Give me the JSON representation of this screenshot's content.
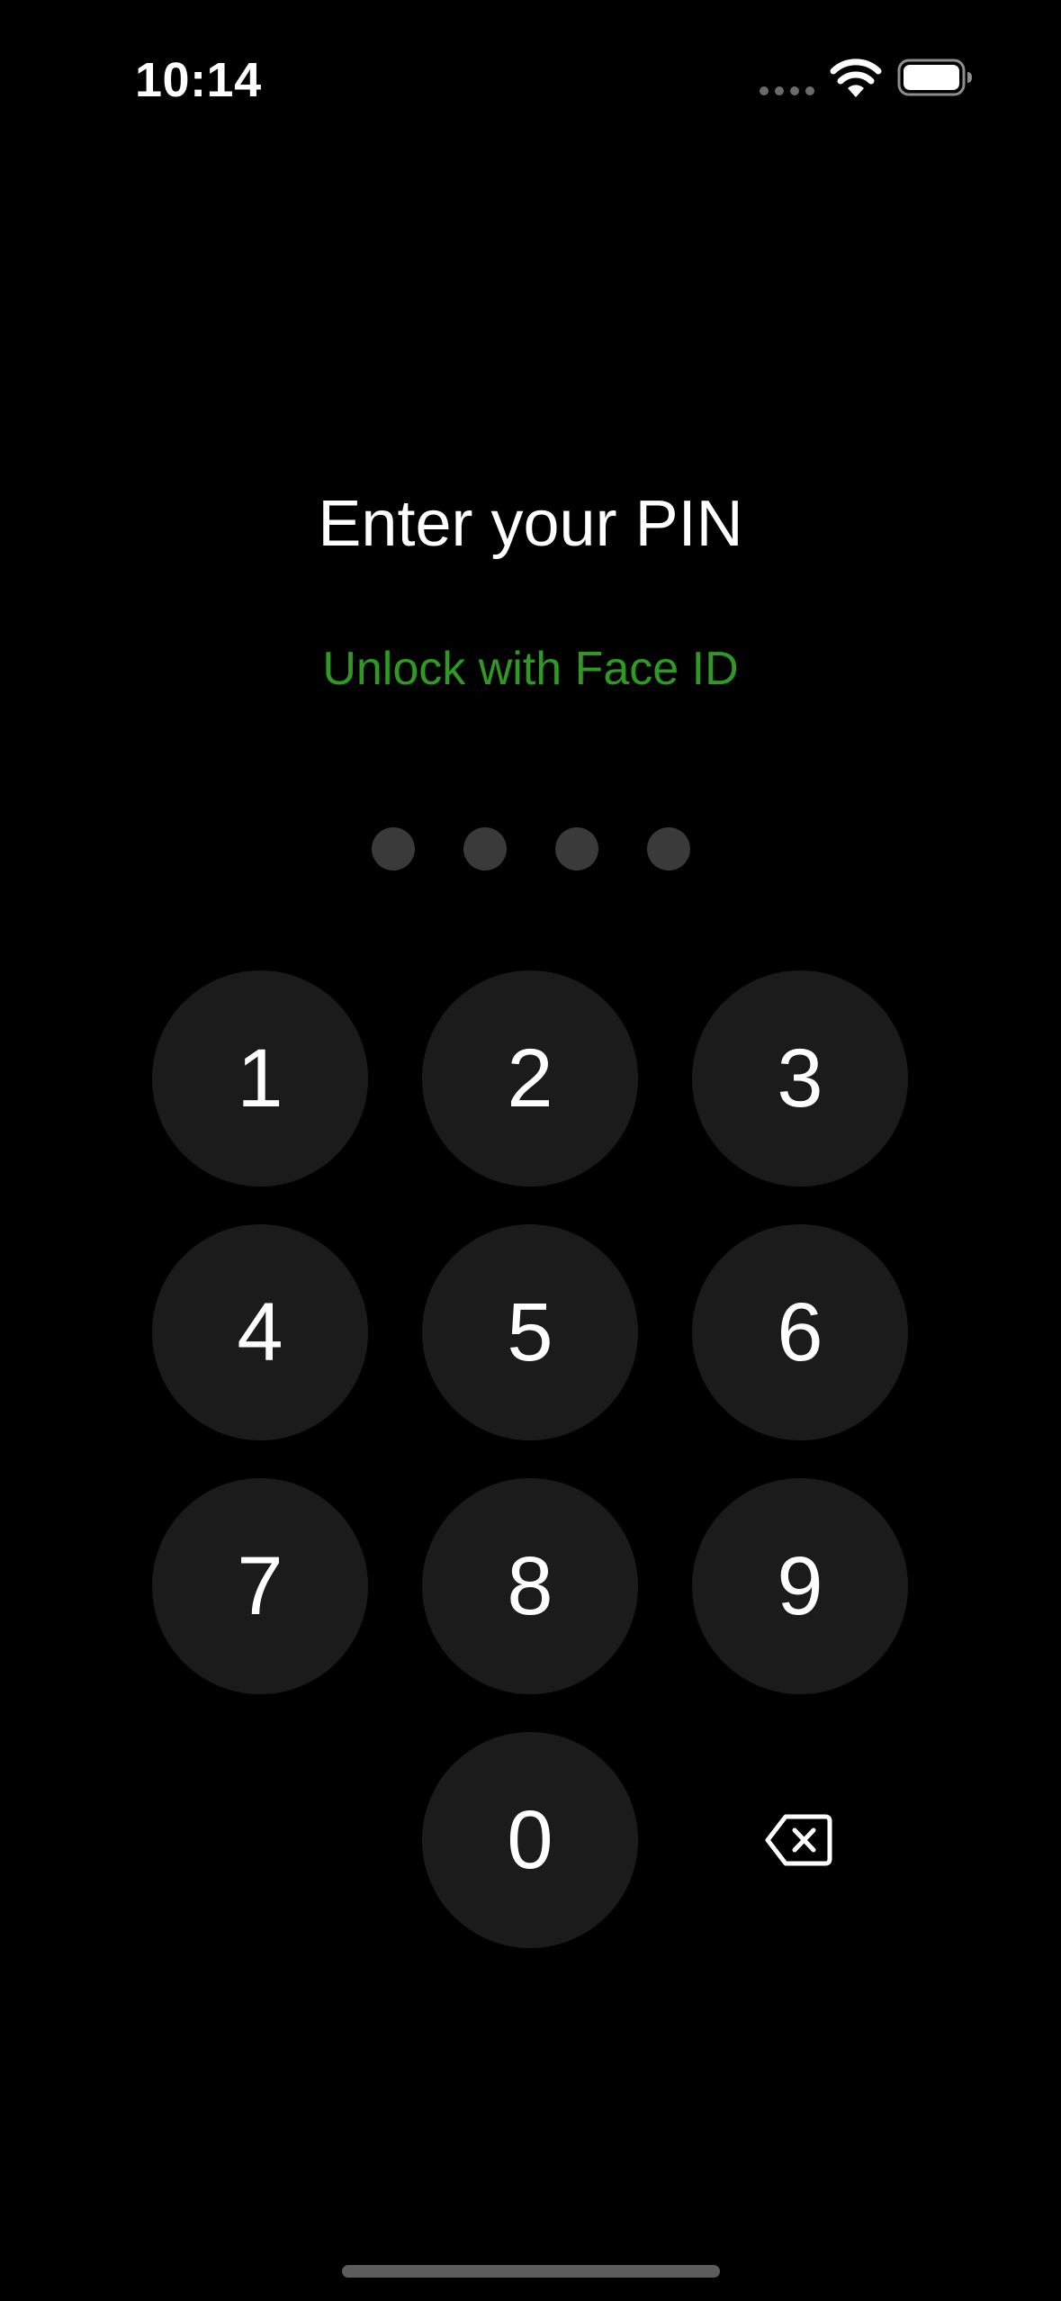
{
  "status_bar": {
    "time": "10:14",
    "icons": [
      "cellular-signal-icon",
      "wifi-icon",
      "battery-icon"
    ]
  },
  "lock_screen": {
    "title": "Enter your PIN",
    "biometric_link": "Unlock with Face ID",
    "pin_length": 4,
    "pin_entered": 0
  },
  "keypad": {
    "keys": [
      "1",
      "2",
      "3",
      "4",
      "5",
      "6",
      "7",
      "8",
      "9",
      "0"
    ],
    "delete_icon": "backspace-icon"
  },
  "colors": {
    "background": "#000000",
    "key_background": "#1b1b1b",
    "accent_green": "#2f9a22",
    "pin_dot_empty": "#3a3a3a",
    "text": "#ffffff"
  }
}
